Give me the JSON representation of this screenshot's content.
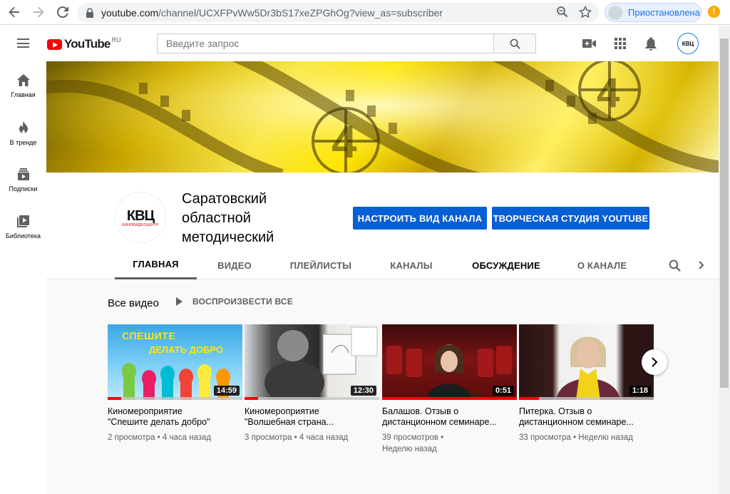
{
  "browser": {
    "url_host": "youtube.com",
    "url_path": "/channel/UCXFPvWw5Dr3bS17xeZPGhOg?view_as=subscriber",
    "profile_label": "Приостановлена",
    "alert_glyph": "!"
  },
  "header": {
    "logo_text": "YouTube",
    "logo_region": "RU",
    "search_placeholder": "Введите запрос",
    "avatar_text": "КВЦ"
  },
  "guide": {
    "items": [
      {
        "label": "Главная",
        "icon": "home-icon"
      },
      {
        "label": "В тренде",
        "icon": "flame-icon"
      },
      {
        "label": "Подписки",
        "icon": "subscriptions-icon"
      },
      {
        "label": "Библиотека",
        "icon": "library-icon"
      }
    ]
  },
  "channel": {
    "avatar_logo": "КВЦ",
    "avatar_sub": "КИНОВИДЕОЦЕНТР",
    "title_line1": "Саратовский",
    "title_line2": "областной",
    "title_line3": "методический",
    "customize_button": "НАСТРОИТЬ ВИД КАНАЛА",
    "studio_button": "ТВОРЧЕСКАЯ СТУДИЯ YOUTUBE",
    "tabs": [
      "ГЛАВНАЯ",
      "ВИДЕО",
      "ПЛЕЙЛИСТЫ",
      "КАНАЛЫ",
      "ОБСУЖДЕНИЕ",
      "О КАНАЛЕ"
    ]
  },
  "shelf": {
    "title": "Все видео",
    "play_all": "ВОСПРОИЗВЕСТИ ВСЕ",
    "videos": [
      {
        "title_line1": "Киномероприятие",
        "title_line2": "\"Спешите делать добро\"",
        "duration": "14:59",
        "meta_line1": "2 просмотра • 4 часа назад",
        "meta_line2": "",
        "thumb_text1": "СПЕШИТЕ",
        "thumb_text2": "ДЕЛАТЬ ДОБРО",
        "progress": 0.1
      },
      {
        "title_line1": "Киномероприятие",
        "title_line2": "\"Волшебная страна...",
        "duration": "12:30",
        "meta_line1": "3 просмотра • 4 часа назад",
        "meta_line2": "",
        "progress": 0.1
      },
      {
        "title_line1": "Балашов. Отзыв о",
        "title_line2": "дистанционном семинаре...",
        "duration": "0:51",
        "meta_line1": "39 просмотров •",
        "meta_line2": "Неделю назад",
        "progress": 1.0
      },
      {
        "title_line1": "Питерка. Отзыв о",
        "title_line2": "дистанционном семинаре...",
        "duration": "1:18",
        "meta_line1": "33 просмотра • Неделю назад",
        "meta_line2": "",
        "progress": 0.15
      }
    ]
  },
  "colors": {
    "accent": "#065fd4",
    "brand_red": "#ff0000"
  }
}
